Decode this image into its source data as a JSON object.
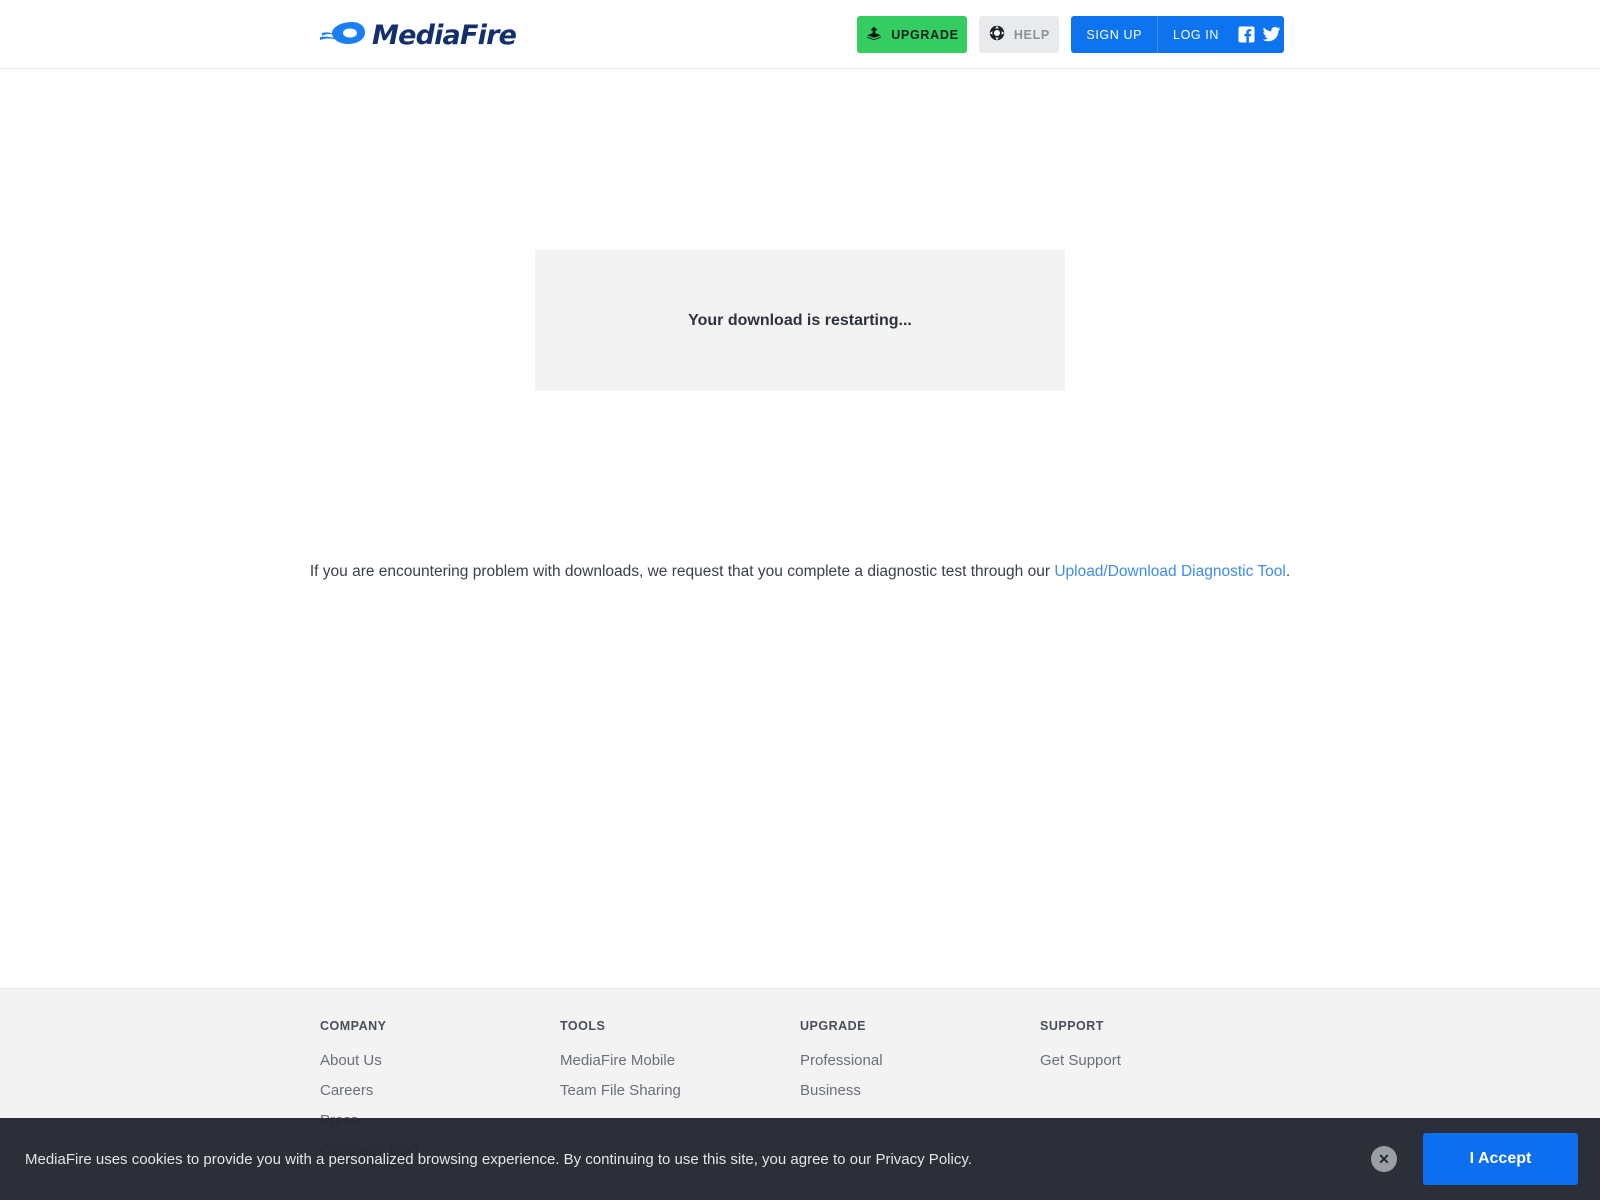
{
  "header": {
    "logo_text": "MediaFire",
    "logo_icon": "mediafire-flame-icon",
    "upgrade_label": "UPGRADE",
    "upgrade_icon": "upload-arrow-icon",
    "upgrade_color": "#35cc61",
    "help_label": "HELP",
    "help_icon": "lifebuoy-icon",
    "signup_label": "SIGN UP",
    "login_label": "LOG IN",
    "auth_color": "#0d73ef",
    "facebook_icon": "facebook-icon",
    "twitter_icon": "twitter-icon"
  },
  "main": {
    "download_status": "Your download is restarting...",
    "diagnostic_prefix": "If you are encountering problem with downloads, we request that you complete a diagnostic test through our ",
    "diagnostic_link": "Upload/Download Diagnostic Tool",
    "diagnostic_suffix": ".",
    "link_color": "#3d8ced",
    "panel_background": "#f3f3f3"
  },
  "footer": {
    "columns": [
      {
        "heading": "COMPANY",
        "links": [
          "About Us",
          "Careers",
          "Press",
          "Company Blog"
        ]
      },
      {
        "heading": "TOOLS",
        "links": [
          "MediaFire Mobile",
          "Team File Sharing"
        ]
      },
      {
        "heading": "UPGRADE",
        "links": [
          "Professional",
          "Business"
        ]
      },
      {
        "heading": "SUPPORT",
        "links": [
          "Get Support"
        ]
      }
    ],
    "background": "#f3f3f4"
  },
  "cookie_banner": {
    "message": "MediaFire uses cookies to provide you with a personalized browsing experience. By continuing to use this site, you agree to our Privacy Policy.",
    "close_icon": "close-icon",
    "accept_label": "I Accept",
    "accept_color": "#0d6ff0",
    "background": "#232730"
  }
}
